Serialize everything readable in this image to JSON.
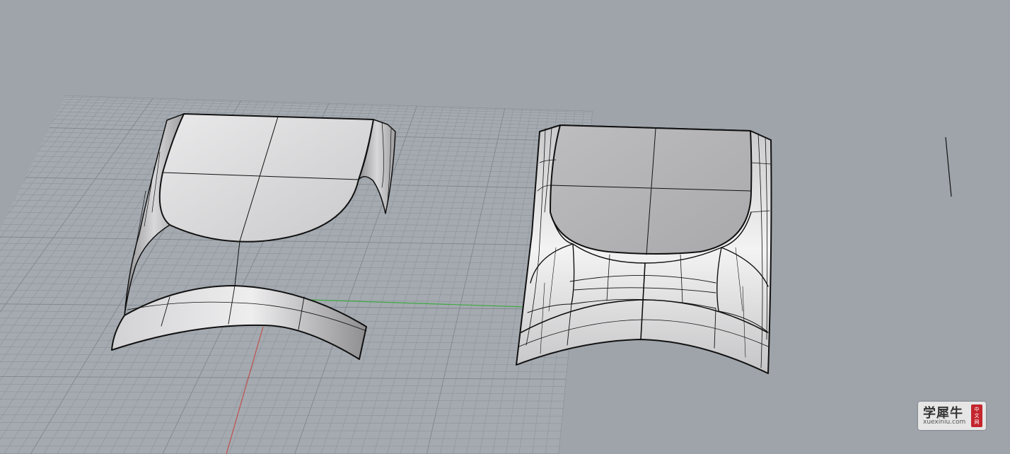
{
  "viewport": {
    "name": "rhino-3d-perspective-viewport",
    "background": "#9ea4aa"
  },
  "axes": {
    "x_axis_color": "#3fa844",
    "y_axis_color": "#c0504d"
  },
  "objects": [
    {
      "label": "left-surface-pair"
    },
    {
      "label": "right-blended-surface"
    }
  ],
  "watermark": {
    "title": "学犀牛",
    "url": "xuexiniu.com",
    "seal_chars": [
      "中",
      "文",
      "网"
    ]
  }
}
